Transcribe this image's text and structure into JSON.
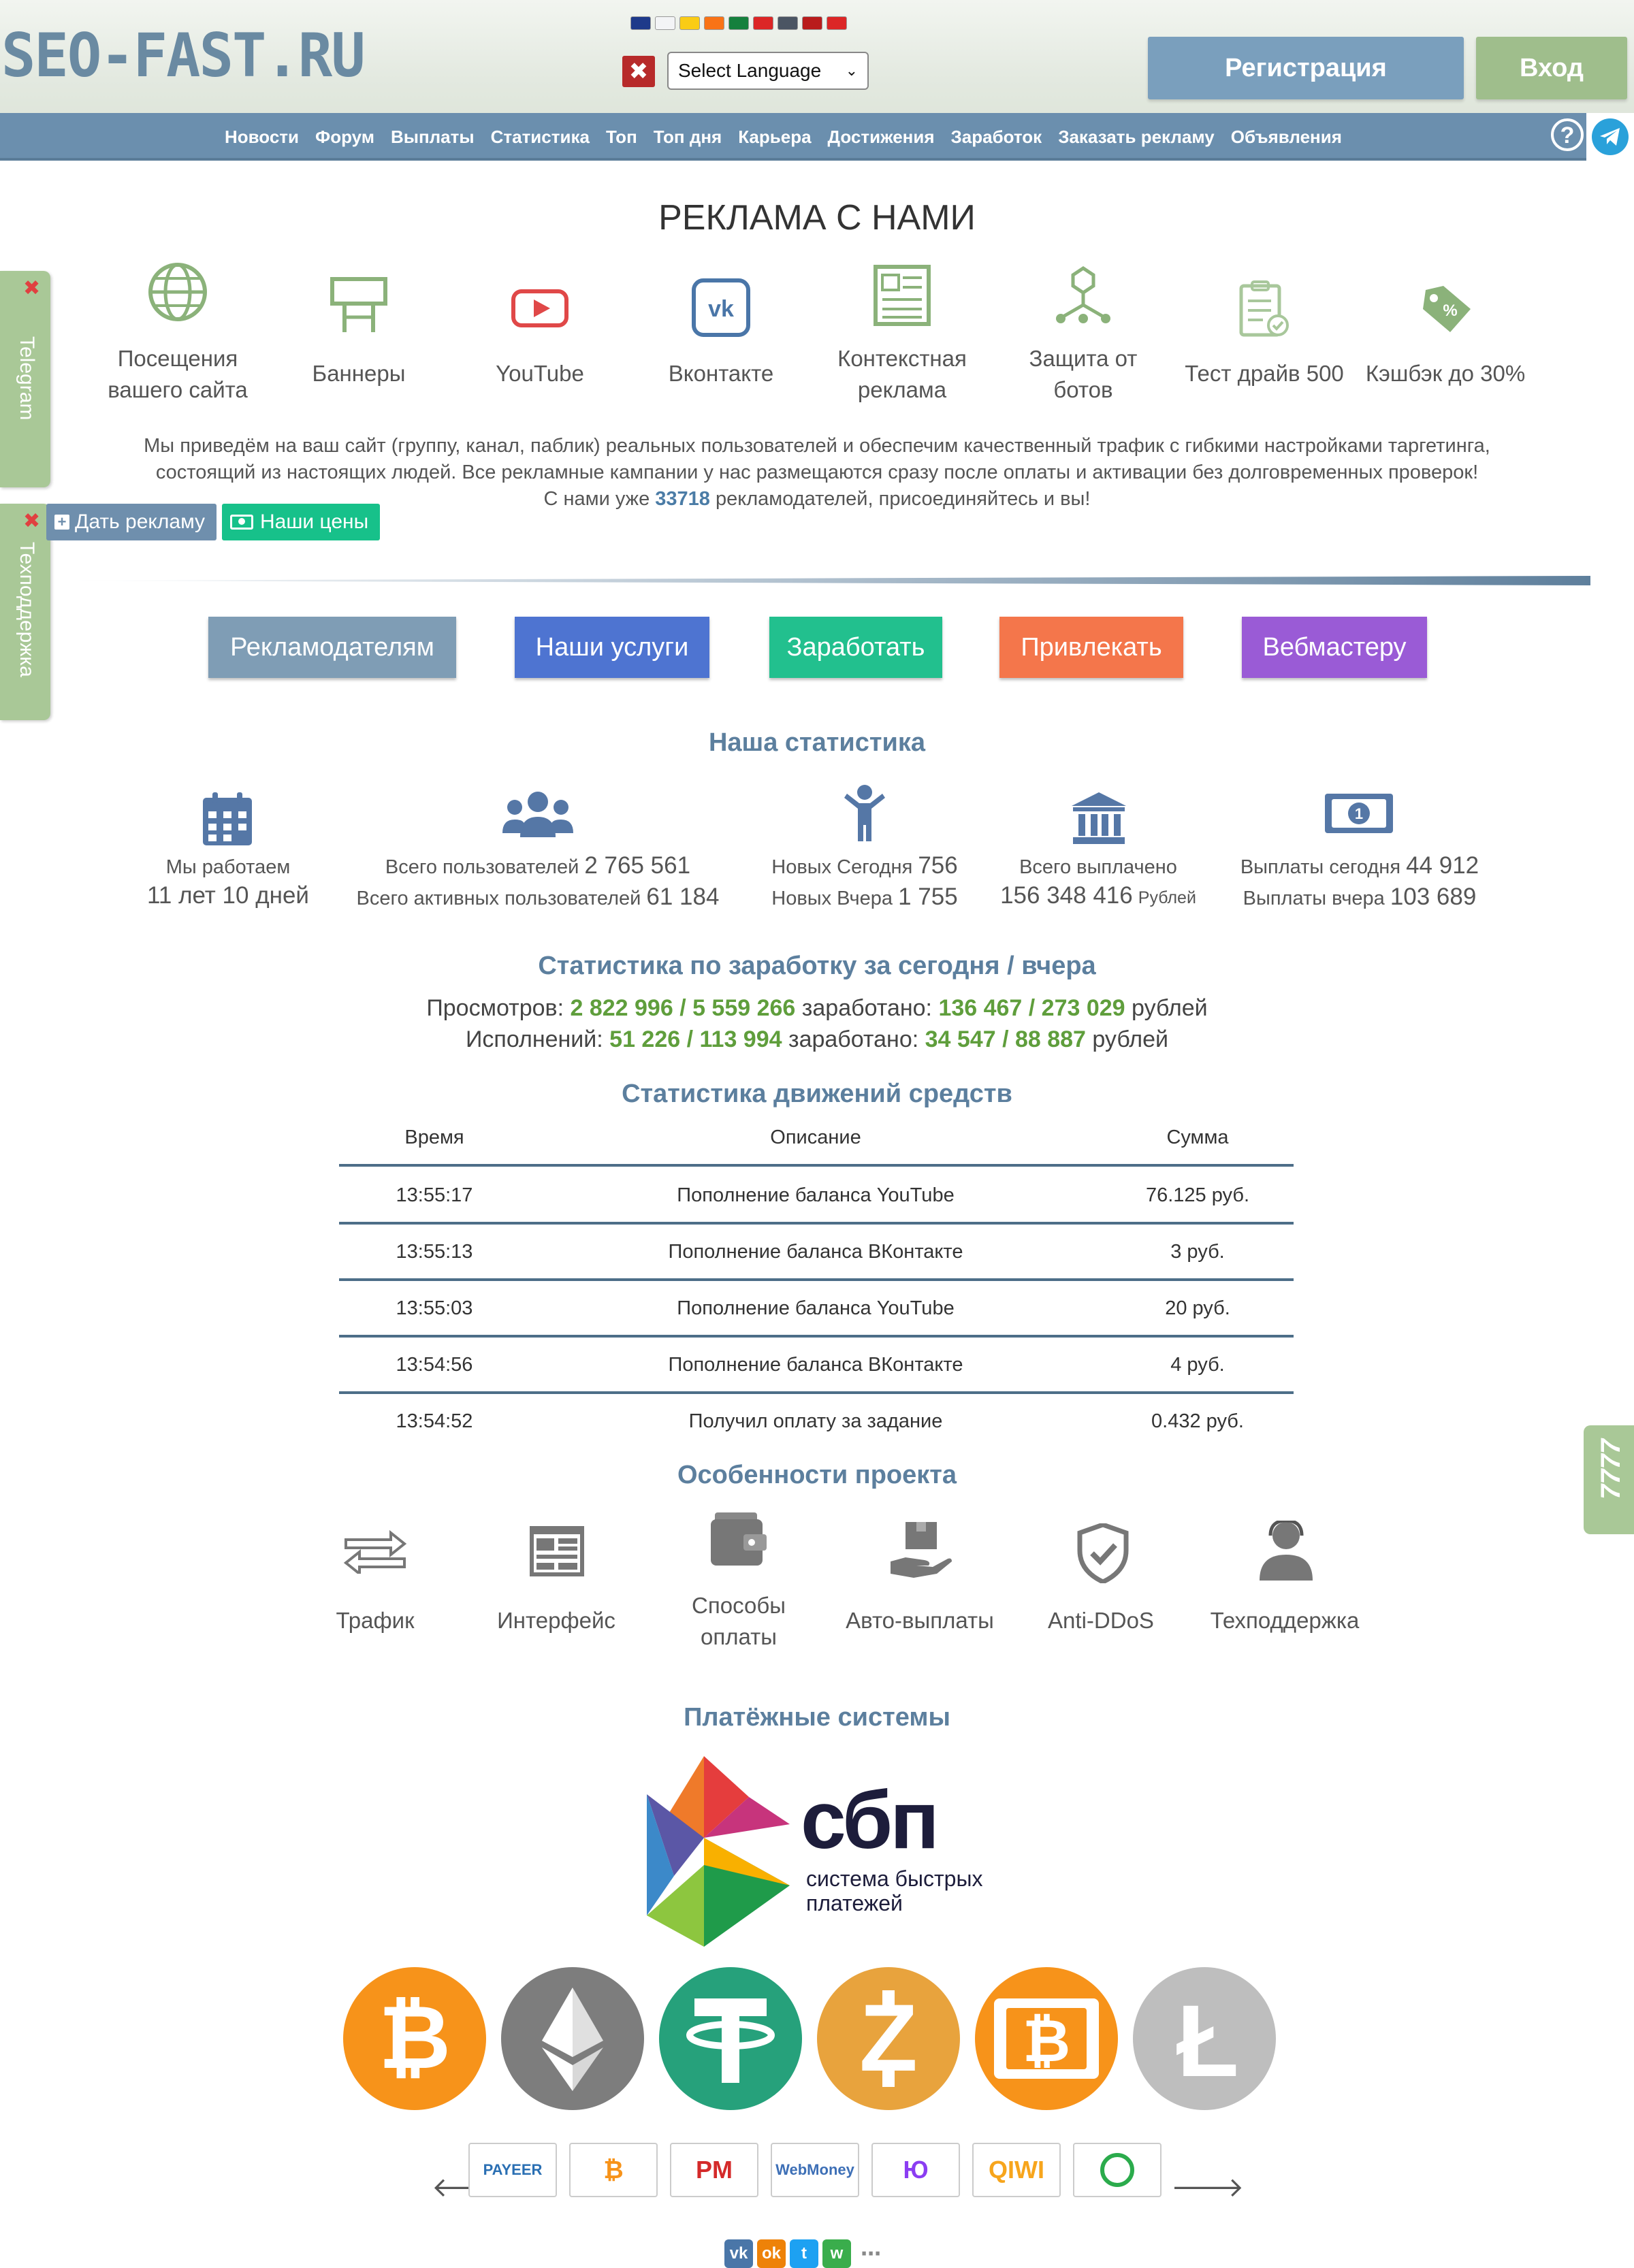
{
  "header": {
    "logo_text": "SEO-FAST.RU",
    "language_select": {
      "value": "Select Language"
    },
    "register_label": "Регистрация",
    "login_label": "Вход",
    "flag_colors": [
      "#1e3a8a",
      "#f3f4f6",
      "#facc15",
      "#f97316",
      "#15803d",
      "#dc2626",
      "#4b5563",
      "#b91c1c",
      "#dc2626"
    ]
  },
  "nav": {
    "items": [
      "Новости",
      "Форум",
      "Выплаты",
      "Статистика",
      "Топ",
      "Топ дня",
      "Карьера",
      "Достижения",
      "Заработок",
      "Заказать рекламу",
      "Объявления"
    ]
  },
  "side_tabs": {
    "telegram": "Telegram",
    "support": "Техподдержка",
    "right": "7777"
  },
  "ad": {
    "title": "РЕКЛАМА С НАМИ",
    "features": [
      {
        "line1": "Посещения",
        "line2": "вашего сайта",
        "icon": "globe-icon"
      },
      {
        "line1": "Баннеры",
        "line2": "",
        "icon": "billboard-icon"
      },
      {
        "line1": "YouTube",
        "line2": "",
        "icon": "youtube-icon"
      },
      {
        "line1": "Вконтакте",
        "line2": "",
        "icon": "vk-icon"
      },
      {
        "line1": "Контекстная",
        "line2": "реклама",
        "icon": "document-icon"
      },
      {
        "line1": "Защита от",
        "line2": "ботов",
        "icon": "shield-network-icon"
      },
      {
        "line1": "Тест драйв 500",
        "line2": "",
        "icon": "checklist-icon"
      },
      {
        "line1": "Кэшбэк до 30%",
        "line2": "",
        "icon": "cashback-tag-icon"
      }
    ],
    "desc_line1": "Мы приведём на ваш сайт (группу, канал, паблик) реальных пользователей и обеспечим качественный трафик с гибкими настройками таргетинга,",
    "desc_line2": "состоящий из настоящих людей. Все рекламные кампании у нас размещаются сразу после оплаты и активации без долговременных проверок!",
    "desc_line3_pre": "С нами уже ",
    "advertisers_count": "33718",
    "desc_line3_post": " рекламодателей, присоединяйтесь и вы!",
    "give_ad_label": "Дать рекламу",
    "prices_label": "Наши цены"
  },
  "big_buttons": [
    {
      "label": "Рекламодателям",
      "color": "#7f9db5"
    },
    {
      "label": "Наши услуги",
      "color": "#4e74d1"
    },
    {
      "label": "Заработать",
      "color": "#22c08e"
    },
    {
      "label": "Привлекать",
      "color": "#f4764b"
    },
    {
      "label": "Вебмастеру",
      "color": "#9a5bd6"
    }
  ],
  "stats": {
    "title": "Наша статистика",
    "work_label": "Мы работаем",
    "work_value": "11 лет 10 дней",
    "users_label": "Всего пользователей",
    "users_value": "2 765 561",
    "active_label": "Всего активных пользователей",
    "active_value": "61 184",
    "new_today_label": "Новых Сегодня",
    "new_today_value": "756",
    "new_yesterday_label": "Новых Вчера",
    "new_yesterday_value": "1 755",
    "paid_total_label": "Всего выплачено",
    "paid_total_value": "156 348 416",
    "paid_total_unit": "Рублей",
    "paid_today_label": "Выплаты сегодня",
    "paid_today_value": "44 912",
    "paid_yesterday_label": "Выплаты вчера",
    "paid_yesterday_value": "103 689"
  },
  "earnings": {
    "title": "Статистика по заработку за сегодня / вчера",
    "views_label": "Просмотров:",
    "views_value": "2 822 996 / 5 559 266",
    "earned_label": "заработано:",
    "views_earned": "136 467 / 273 029",
    "currency": "рублей",
    "tasks_label": "Исполнений:",
    "tasks_value": "51 226 / 113 994",
    "tasks_earned": "34 547 / 88 887"
  },
  "movements": {
    "title": "Статистика движений средств",
    "headers": [
      "Время",
      "Описание",
      "Сумма"
    ],
    "rows": [
      [
        "13:55:17",
        "Пополнение баланса YouTube",
        "76.125 руб."
      ],
      [
        "13:55:13",
        "Пополнение баланса ВКонтакте",
        "3 руб."
      ],
      [
        "13:55:03",
        "Пополнение баланса YouTube",
        "20 руб."
      ],
      [
        "13:54:56",
        "Пополнение баланса ВКонтакте",
        "4 руб."
      ],
      [
        "13:54:52",
        "Получил оплату за задание",
        "0.432 руб."
      ]
    ]
  },
  "project": {
    "title": "Особенности проекта",
    "items": [
      {
        "line1": "Трафик",
        "line2": "",
        "icon": "traffic-arrows-icon"
      },
      {
        "line1": "Интерфейс",
        "line2": "",
        "icon": "interface-icon"
      },
      {
        "line1": "Способы",
        "line2": "оплаты",
        "icon": "wallet-icon"
      },
      {
        "line1": "Авто-выплаты",
        "line2": "",
        "icon": "auto-payout-icon"
      },
      {
        "line1": "Anti-DDoS",
        "line2": "",
        "icon": "shield-check-icon"
      },
      {
        "line1": "Техподдержка",
        "line2": "",
        "icon": "support-agent-icon"
      }
    ]
  },
  "payments": {
    "title": "Платёжные системы",
    "sbp_word": "сбп",
    "sbp_line1": "система быстрых",
    "sbp_line2": "платежей",
    "crypto": [
      {
        "icon": "bitcoin-icon",
        "color": "#f7931a"
      },
      {
        "icon": "ethereum-icon",
        "color": "#7d7d7d"
      },
      {
        "icon": "tether-icon",
        "color": "#26a17b"
      },
      {
        "icon": "zcash-icon",
        "color": "#e8a33d"
      },
      {
        "icon": "bitcoin-cash-icon",
        "color": "#f7931a"
      },
      {
        "icon": "litecoin-icon",
        "color": "#bebebe"
      }
    ],
    "small": [
      {
        "icon": "payeer-icon",
        "text": "PAYEER"
      },
      {
        "icon": "bitcoin-small-icon",
        "text": "₿"
      },
      {
        "icon": "perfect-money-icon",
        "text": "PM"
      },
      {
        "icon": "webmoney-icon",
        "text": "WebMoney"
      },
      {
        "icon": "yoomoney-icon",
        "text": "Ю"
      },
      {
        "icon": "qiwi-icon",
        "text": "QIWI"
      },
      {
        "icon": "sberbank-icon",
        "text": ""
      }
    ]
  }
}
